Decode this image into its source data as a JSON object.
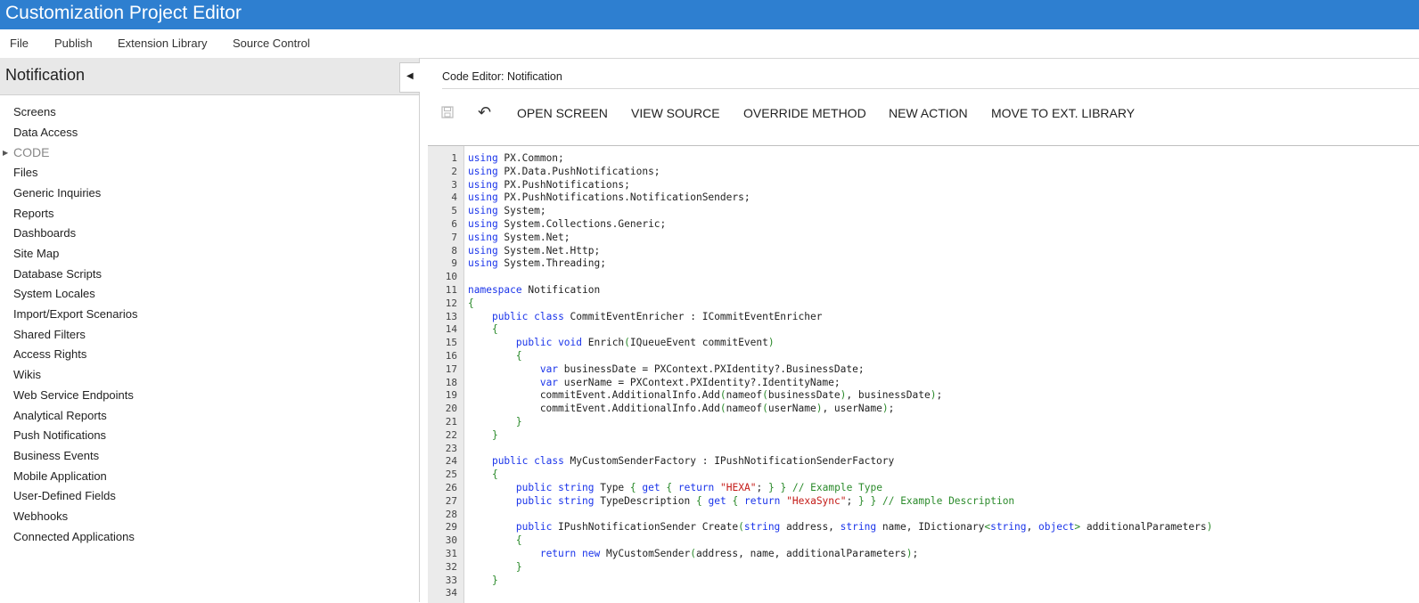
{
  "app": {
    "title": "Customization Project Editor"
  },
  "menu": [
    "File",
    "Publish",
    "Extension Library",
    "Source Control"
  ],
  "sidebar": {
    "title": "Notification",
    "items": [
      {
        "label": "Screens"
      },
      {
        "label": "Data Access"
      },
      {
        "label": "CODE",
        "active": true
      },
      {
        "label": "Files"
      },
      {
        "label": "Generic Inquiries"
      },
      {
        "label": "Reports"
      },
      {
        "label": "Dashboards"
      },
      {
        "label": "Site Map"
      },
      {
        "label": "Database Scripts"
      },
      {
        "label": "System Locales"
      },
      {
        "label": "Import/Export Scenarios"
      },
      {
        "label": "Shared Filters"
      },
      {
        "label": "Access Rights"
      },
      {
        "label": "Wikis"
      },
      {
        "label": "Web Service Endpoints"
      },
      {
        "label": "Analytical Reports"
      },
      {
        "label": "Push Notifications"
      },
      {
        "label": "Business Events"
      },
      {
        "label": "Mobile Application"
      },
      {
        "label": "User-Defined Fields"
      },
      {
        "label": "Webhooks"
      },
      {
        "label": "Connected Applications"
      }
    ]
  },
  "editor": {
    "title": "Code Editor: Notification",
    "icons": {
      "save": "save-icon",
      "undo": "undo-icon"
    },
    "toolbar": [
      "OPEN SCREEN",
      "VIEW SOURCE",
      "OVERRIDE METHOD",
      "NEW ACTION",
      "MOVE TO EXT. LIBRARY"
    ],
    "lines": [
      "using PX.Common;",
      "using PX.Data.PushNotifications;",
      "using PX.PushNotifications;",
      "using PX.PushNotifications.NotificationSenders;",
      "using System;",
      "using System.Collections.Generic;",
      "using System.Net;",
      "using System.Net.Http;",
      "using System.Threading;",
      "",
      "namespace Notification",
      "{",
      "    public class CommitEventEnricher : ICommitEventEnricher",
      "    {",
      "        public void Enrich(IQueueEvent commitEvent)",
      "        {",
      "            var businessDate = PXContext.PXIdentity?.BusinessDate;",
      "            var userName = PXContext.PXIdentity?.IdentityName;",
      "            commitEvent.AdditionalInfo.Add(nameof(businessDate), businessDate);",
      "            commitEvent.AdditionalInfo.Add(nameof(userName), userName);",
      "        }",
      "    }",
      "",
      "    public class MyCustomSenderFactory : IPushNotificationSenderFactory",
      "    {",
      "        public string Type { get { return \"HEXA\"; } } // Example Type",
      "        public string TypeDescription { get { return \"HexaSync\"; } } // Example Description",
      "",
      "        public IPushNotificationSender Create(string address, string name, IDictionary<string, object> additionalParameters)",
      "        {",
      "            return new MyCustomSender(address, name, additionalParameters);",
      "        }",
      "    }",
      ""
    ]
  },
  "colors": {
    "titlebar": "#2e7fd0",
    "keyword": "#1a34ea",
    "string": "#c41a16",
    "comment": "#2a8a2a"
  }
}
